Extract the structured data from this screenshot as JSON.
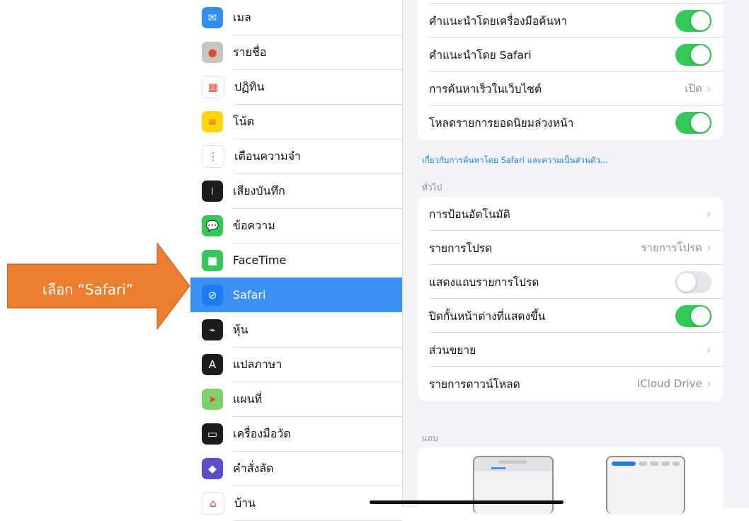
{
  "sidebar": {
    "items": [
      {
        "label": "เมล",
        "icon": "mail-icon",
        "color": "#2f8ff0"
      },
      {
        "label": "รายชื่อ",
        "icon": "contacts-icon",
        "color": "#c9c4bd"
      },
      {
        "label": "ปฏิทิน",
        "icon": "calendar-icon",
        "color": "#ffffff"
      },
      {
        "label": "โน้ต",
        "icon": "notes-icon",
        "color": "#ffd60a"
      },
      {
        "label": "เตือนความจำ",
        "icon": "reminders-icon",
        "color": "#ffffff"
      },
      {
        "label": "เสียงบันทึก",
        "icon": "voice-memos-icon",
        "color": "#1c1c1e"
      },
      {
        "label": "ข้อความ",
        "icon": "messages-icon",
        "color": "#34c759"
      },
      {
        "label": "FaceTime",
        "icon": "facetime-icon",
        "color": "#34c759"
      },
      {
        "label": "Safari",
        "icon": "safari-icon",
        "color": "#1e7cf2",
        "selected": true
      },
      {
        "label": "หุ้น",
        "icon": "stocks-icon",
        "color": "#1c1c1e"
      },
      {
        "label": "แปลภาษา",
        "icon": "translate-icon",
        "color": "#1c1c1e"
      },
      {
        "label": "แผนที่",
        "icon": "maps-icon",
        "color": "#7fcf6a"
      },
      {
        "label": "เครื่องมือวัด",
        "icon": "measure-icon",
        "color": "#1c1c1e"
      },
      {
        "label": "คำสั่งลัด",
        "icon": "shortcuts-icon",
        "color": "#5b4ec8"
      },
      {
        "label": "บ้าน",
        "icon": "home-icon",
        "color": "#ffffff"
      }
    ]
  },
  "annotation": {
    "text": "เลือก “Safari”",
    "color": "#ed7d31"
  },
  "search_group": {
    "rows": [
      {
        "label": "คำแนะนำโดยเครื่องมือค้นหา",
        "toggle": "on"
      },
      {
        "label": "คำแนะนำโดย Safari",
        "toggle": "on"
      },
      {
        "label": "การค้นหาเร็วในเว็บไซต์",
        "value": "เปิด",
        "chevron": true
      },
      {
        "label": "โหลดรายการยอดนิยมล่วงหน้า",
        "toggle": "on"
      }
    ],
    "footer_link": "เกี่ยวกับการค้นหาโดย Safari และความเป็นส่วนตัว..."
  },
  "general_group": {
    "header": "ทั่วไป",
    "rows": [
      {
        "label": "การป้อนอัตโนมัติ",
        "chevron": true
      },
      {
        "label": "รายการโปรด",
        "value": "รายการโปรด",
        "chevron": true
      },
      {
        "label": "แสดงแถบรายการโปรด",
        "toggle": "off"
      },
      {
        "label": "ปิดกั้นหน้าต่างที่แสดงขึ้น",
        "toggle": "on"
      },
      {
        "label": "ส่วนขยาย",
        "chevron": true
      },
      {
        "label": "รายการดาวน์โหลด",
        "value": "iCloud Drive",
        "chevron": true
      }
    ]
  },
  "tabs_group": {
    "header": "แถบ"
  },
  "colors": {
    "accent": "#3d91f5",
    "toggle_on": "#34c759",
    "link": "#1e80f0"
  }
}
